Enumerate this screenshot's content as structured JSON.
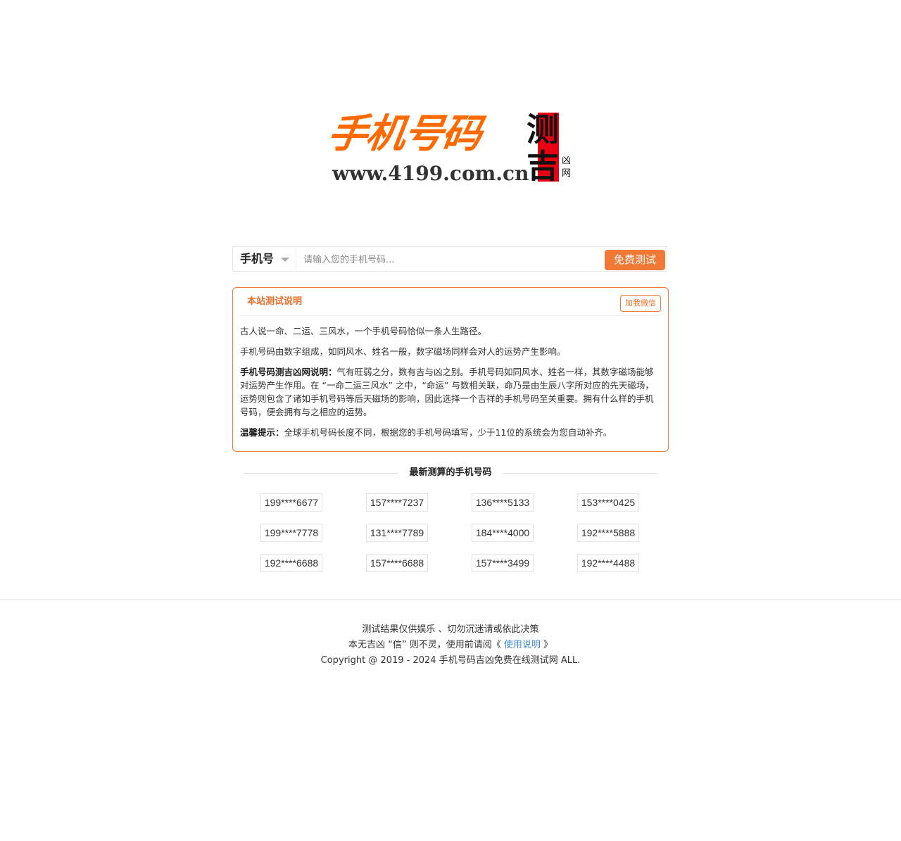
{
  "logo": {
    "title": "手机号码",
    "calligraphy": [
      "测",
      "吉"
    ],
    "small": [
      "凶",
      "网"
    ],
    "url": "www.4199.com.cn"
  },
  "search": {
    "type_label": "手机号",
    "placeholder": "请输入您的手机号码...",
    "button_label": "免费测试"
  },
  "info": {
    "title": "本站测试说明",
    "wechat_label": "加我微信",
    "para1": "古人说一命、二运、三风水，一个手机号码恰似一条人生路径。",
    "para2": "手机号码由数字组成，如同风水、姓名一般，数字磁场同样会对人的运势产生影响。",
    "para3_label": "手机号码测吉凶网说明：",
    "para3_text": "气有旺弱之分，数有吉与凶之别。手机号码如同风水、姓名一样，其数字磁场能够对运势产生作用。在 “一命二运三风水” 之中，“命运” 与数相关联，命乃是由生辰八字所对应的先天磁场，运势则包含了诸如手机号码等后天磁场的影响，因此选择一个吉祥的手机号码至关重要。拥有什么样的手机号码，便会拥有与之相应的运势。",
    "tip_label": "温馨提示：",
    "tip_text": "全球手机号码长度不同，根据您的手机号码填写，少于11位的系统会为您自动补齐。"
  },
  "latest": {
    "title": "最新测算的手机号码",
    "numbers": [
      "199****6677",
      "157****7237",
      "136****5133",
      "153****0425",
      "199****7778",
      "131****7789",
      "184****4000",
      "192****5888",
      "192****6688",
      "157****6688",
      "157****3499",
      "192****4488"
    ]
  },
  "footer": {
    "line1": "测试结果仅供娱乐 、切勿沉迷请或依此决策",
    "line2_prefix": "本无吉凶 “信” 则不灵，使用前请阅《 ",
    "line2_link": "使用说明",
    "line2_suffix": " 》",
    "copyright": "Copyright @ 2019 - 2024 手机号码吉凶免费在线测试网 ALL."
  },
  "colors": {
    "accent": "#f07a35",
    "logo_orange": "#ff6a00",
    "logo_red": "#e60012",
    "link": "#3f86d8"
  }
}
